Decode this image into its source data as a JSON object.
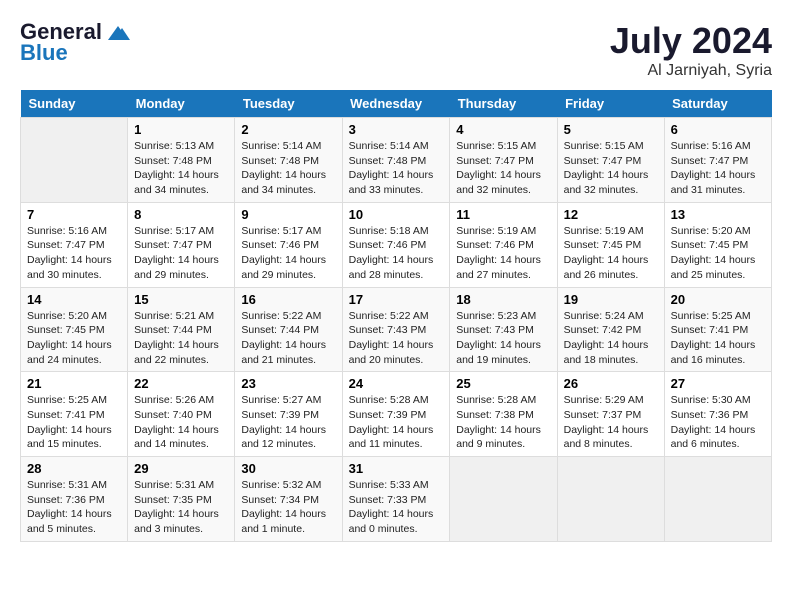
{
  "header": {
    "logo_line1": "General",
    "logo_line2": "Blue",
    "month_year": "July 2024",
    "location": "Al Jarniyah, Syria"
  },
  "columns": [
    "Sunday",
    "Monday",
    "Tuesday",
    "Wednesday",
    "Thursday",
    "Friday",
    "Saturday"
  ],
  "weeks": [
    [
      {
        "day": "",
        "info": ""
      },
      {
        "day": "1",
        "info": "Sunrise: 5:13 AM\nSunset: 7:48 PM\nDaylight: 14 hours\nand 34 minutes."
      },
      {
        "day": "2",
        "info": "Sunrise: 5:14 AM\nSunset: 7:48 PM\nDaylight: 14 hours\nand 34 minutes."
      },
      {
        "day": "3",
        "info": "Sunrise: 5:14 AM\nSunset: 7:48 PM\nDaylight: 14 hours\nand 33 minutes."
      },
      {
        "day": "4",
        "info": "Sunrise: 5:15 AM\nSunset: 7:47 PM\nDaylight: 14 hours\nand 32 minutes."
      },
      {
        "day": "5",
        "info": "Sunrise: 5:15 AM\nSunset: 7:47 PM\nDaylight: 14 hours\nand 32 minutes."
      },
      {
        "day": "6",
        "info": "Sunrise: 5:16 AM\nSunset: 7:47 PM\nDaylight: 14 hours\nand 31 minutes."
      }
    ],
    [
      {
        "day": "7",
        "info": "Sunrise: 5:16 AM\nSunset: 7:47 PM\nDaylight: 14 hours\nand 30 minutes."
      },
      {
        "day": "8",
        "info": "Sunrise: 5:17 AM\nSunset: 7:47 PM\nDaylight: 14 hours\nand 29 minutes."
      },
      {
        "day": "9",
        "info": "Sunrise: 5:17 AM\nSunset: 7:46 PM\nDaylight: 14 hours\nand 29 minutes."
      },
      {
        "day": "10",
        "info": "Sunrise: 5:18 AM\nSunset: 7:46 PM\nDaylight: 14 hours\nand 28 minutes."
      },
      {
        "day": "11",
        "info": "Sunrise: 5:19 AM\nSunset: 7:46 PM\nDaylight: 14 hours\nand 27 minutes."
      },
      {
        "day": "12",
        "info": "Sunrise: 5:19 AM\nSunset: 7:45 PM\nDaylight: 14 hours\nand 26 minutes."
      },
      {
        "day": "13",
        "info": "Sunrise: 5:20 AM\nSunset: 7:45 PM\nDaylight: 14 hours\nand 25 minutes."
      }
    ],
    [
      {
        "day": "14",
        "info": "Sunrise: 5:20 AM\nSunset: 7:45 PM\nDaylight: 14 hours\nand 24 minutes."
      },
      {
        "day": "15",
        "info": "Sunrise: 5:21 AM\nSunset: 7:44 PM\nDaylight: 14 hours\nand 22 minutes."
      },
      {
        "day": "16",
        "info": "Sunrise: 5:22 AM\nSunset: 7:44 PM\nDaylight: 14 hours\nand 21 minutes."
      },
      {
        "day": "17",
        "info": "Sunrise: 5:22 AM\nSunset: 7:43 PM\nDaylight: 14 hours\nand 20 minutes."
      },
      {
        "day": "18",
        "info": "Sunrise: 5:23 AM\nSunset: 7:43 PM\nDaylight: 14 hours\nand 19 minutes."
      },
      {
        "day": "19",
        "info": "Sunrise: 5:24 AM\nSunset: 7:42 PM\nDaylight: 14 hours\nand 18 minutes."
      },
      {
        "day": "20",
        "info": "Sunrise: 5:25 AM\nSunset: 7:41 PM\nDaylight: 14 hours\nand 16 minutes."
      }
    ],
    [
      {
        "day": "21",
        "info": "Sunrise: 5:25 AM\nSunset: 7:41 PM\nDaylight: 14 hours\nand 15 minutes."
      },
      {
        "day": "22",
        "info": "Sunrise: 5:26 AM\nSunset: 7:40 PM\nDaylight: 14 hours\nand 14 minutes."
      },
      {
        "day": "23",
        "info": "Sunrise: 5:27 AM\nSunset: 7:39 PM\nDaylight: 14 hours\nand 12 minutes."
      },
      {
        "day": "24",
        "info": "Sunrise: 5:28 AM\nSunset: 7:39 PM\nDaylight: 14 hours\nand 11 minutes."
      },
      {
        "day": "25",
        "info": "Sunrise: 5:28 AM\nSunset: 7:38 PM\nDaylight: 14 hours\nand 9 minutes."
      },
      {
        "day": "26",
        "info": "Sunrise: 5:29 AM\nSunset: 7:37 PM\nDaylight: 14 hours\nand 8 minutes."
      },
      {
        "day": "27",
        "info": "Sunrise: 5:30 AM\nSunset: 7:36 PM\nDaylight: 14 hours\nand 6 minutes."
      }
    ],
    [
      {
        "day": "28",
        "info": "Sunrise: 5:31 AM\nSunset: 7:36 PM\nDaylight: 14 hours\nand 5 minutes."
      },
      {
        "day": "29",
        "info": "Sunrise: 5:31 AM\nSunset: 7:35 PM\nDaylight: 14 hours\nand 3 minutes."
      },
      {
        "day": "30",
        "info": "Sunrise: 5:32 AM\nSunset: 7:34 PM\nDaylight: 14 hours\nand 1 minute."
      },
      {
        "day": "31",
        "info": "Sunrise: 5:33 AM\nSunset: 7:33 PM\nDaylight: 14 hours\nand 0 minutes."
      },
      {
        "day": "",
        "info": ""
      },
      {
        "day": "",
        "info": ""
      },
      {
        "day": "",
        "info": ""
      }
    ]
  ]
}
